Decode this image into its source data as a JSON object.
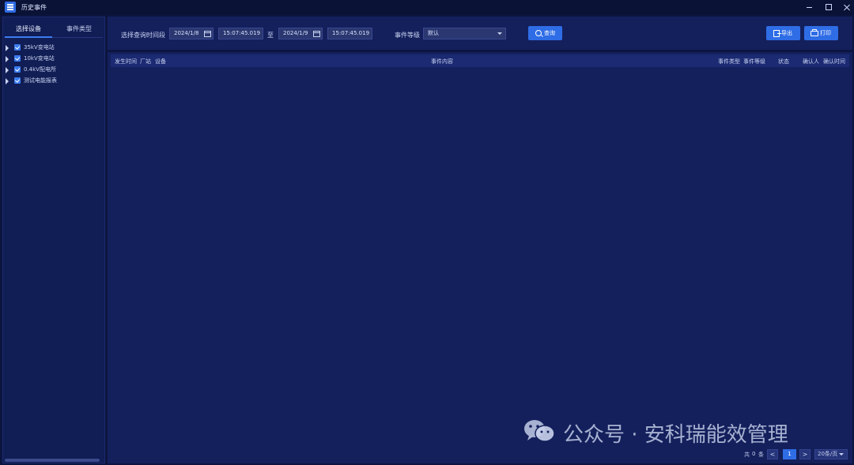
{
  "window": {
    "title": "历史事件"
  },
  "left_panel": {
    "tabs": [
      "选择设备",
      "事件类型"
    ],
    "tree": [
      {
        "label": "35kV变电站"
      },
      {
        "label": "10kV变电站"
      },
      {
        "label": "0.4kV配电所"
      },
      {
        "label": "测试电能报表"
      }
    ]
  },
  "toolbar": {
    "period_label": "选择查询时间段",
    "start_date": "2024/1/8",
    "start_time": "15:07:45.019",
    "to_label": "至",
    "end_date": "2024/1/9",
    "end_time": "15:07:45.019",
    "level_label": "事件等级",
    "level_value": "默认",
    "query_button": "查询",
    "export_button": "导出",
    "print_button": "打印"
  },
  "table": {
    "columns": [
      "发生时间",
      "厂站",
      "设备",
      "事件内容",
      "事件类型",
      "事件等级",
      "状态",
      "确认人",
      "确认时间"
    ],
    "rows": []
  },
  "pagination": {
    "total_prefix": "共",
    "total": "0",
    "total_suffix": "条",
    "prev": "<",
    "current_page": "1",
    "next": ">",
    "page_size": "20条/页"
  },
  "watermark": {
    "text": "公众号 · 安科瑞能效管理"
  },
  "colors": {
    "accent": "#2f6de6",
    "background": "#0c1540",
    "panel": "#14205c"
  }
}
